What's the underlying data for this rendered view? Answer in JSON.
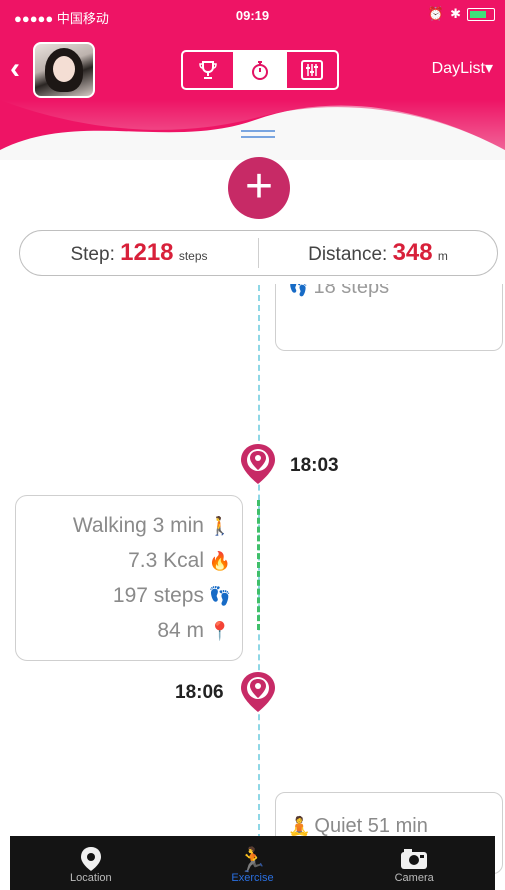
{
  "status": {
    "carrier": "●●●●● 中国移动",
    "time": "09:19"
  },
  "header": {
    "back": "‹",
    "segments": [
      "trophy",
      "stopwatch",
      "equalizer"
    ],
    "active_segment": 1,
    "daylist": "DayList▾"
  },
  "summary": {
    "step_label": "Step:",
    "step_value": "1218",
    "step_unit": "steps",
    "distance_label": "Distance:",
    "distance_value": "348",
    "distance_unit": "m"
  },
  "timeline": {
    "top_card_text": "18 steps",
    "pin1_time": "18:03",
    "walk": {
      "activity": "Walking 3 min",
      "kcal": "7.3 Kcal",
      "steps": "197 steps",
      "distance": "84 m"
    },
    "pin2_time": "18:06",
    "quiet": "Quiet 51 min"
  },
  "nav": {
    "items": [
      {
        "label": "Location",
        "icon": "location-pin-icon"
      },
      {
        "label": "Exercise",
        "icon": "runner-icon"
      },
      {
        "label": "Camera",
        "icon": "camera-icon"
      }
    ],
    "active": 1
  },
  "colors": {
    "brand_pink": "#e21263",
    "accent_red": "#d8203a",
    "pin": "#c72a66",
    "nav_active": "#2a6fe0"
  }
}
